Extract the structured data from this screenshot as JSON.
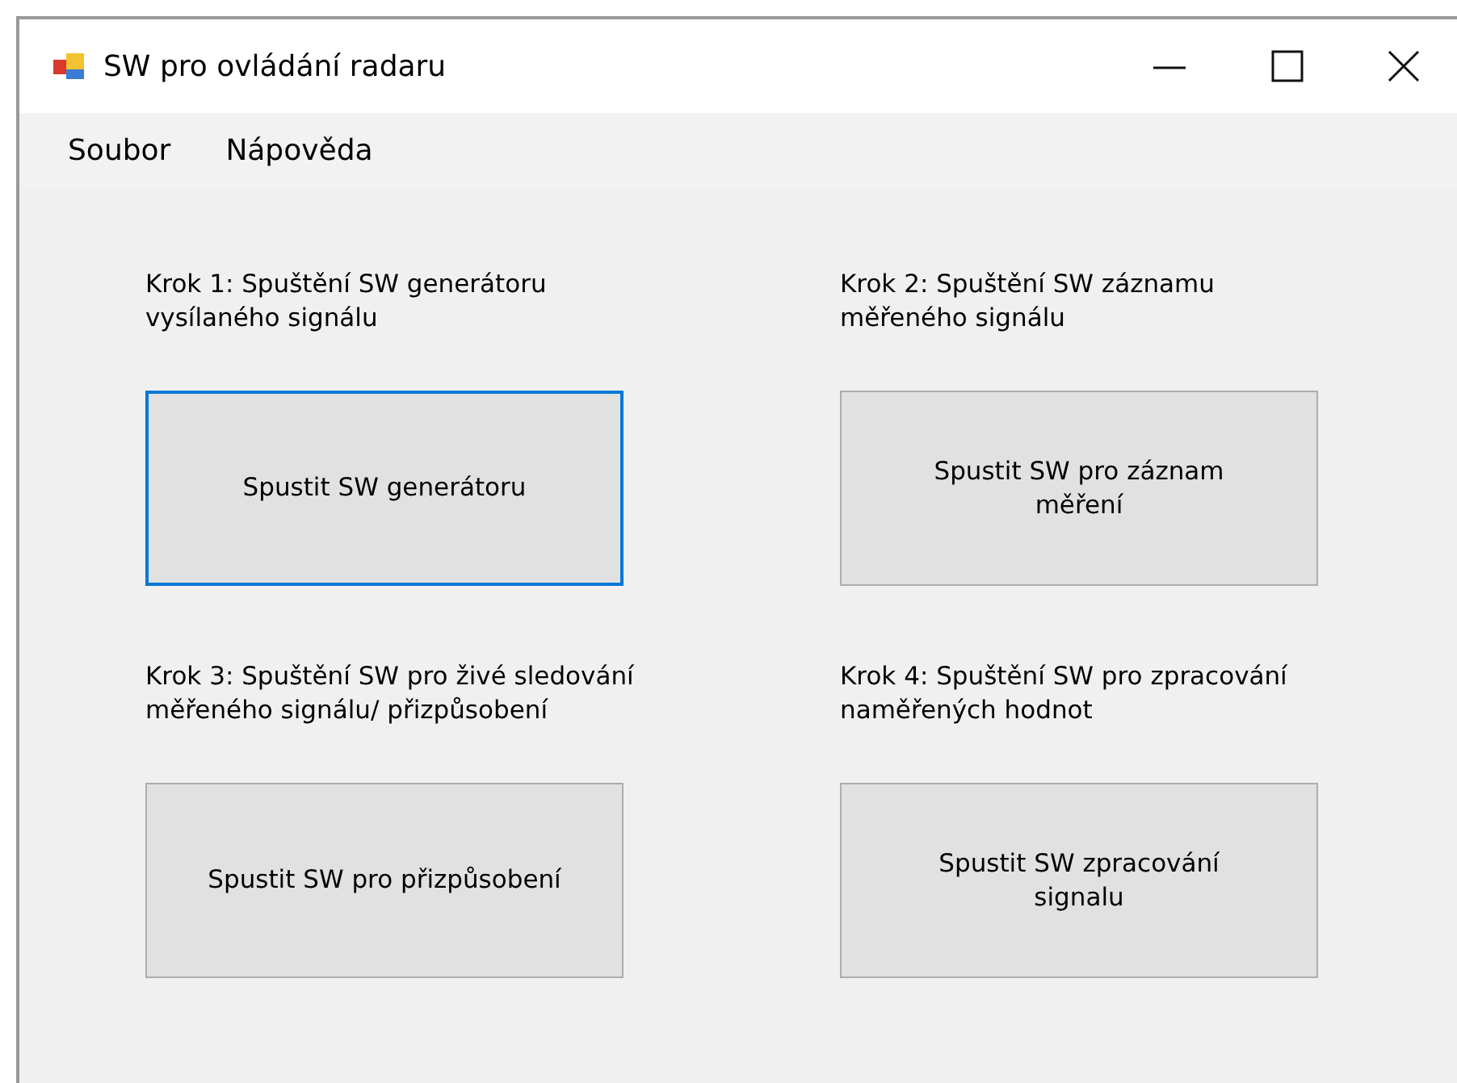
{
  "window": {
    "title": "SW pro ovládání radaru"
  },
  "menu": [
    "Soubor",
    "Nápověda"
  ],
  "steps": [
    {
      "label": [
        "Krok 1: Spuštění SW generátoru",
        " vysílaného signálu"
      ],
      "button": [
        "Spustit SW generátoru"
      ],
      "focused": true
    },
    {
      "label": [
        "Krok 2: Spuštění SW záznamu",
        "měřeného signálu"
      ],
      "button": [
        "Spustit SW pro záznam",
        "měření"
      ],
      "focused": false
    },
    {
      "label": [
        "Krok 3: Spuštění SW pro živé sledování",
        "měřeného signálu/ přizpůsobení"
      ],
      "button": [
        "Spustit SW pro přizpůsobení"
      ],
      "focused": false
    },
    {
      "label": [
        "Krok 4: Spuštění SW pro zpracování",
        "naměřených hodnot"
      ],
      "button": [
        "Spustit SW zpracování",
        "signalu"
      ],
      "focused": false
    }
  ]
}
